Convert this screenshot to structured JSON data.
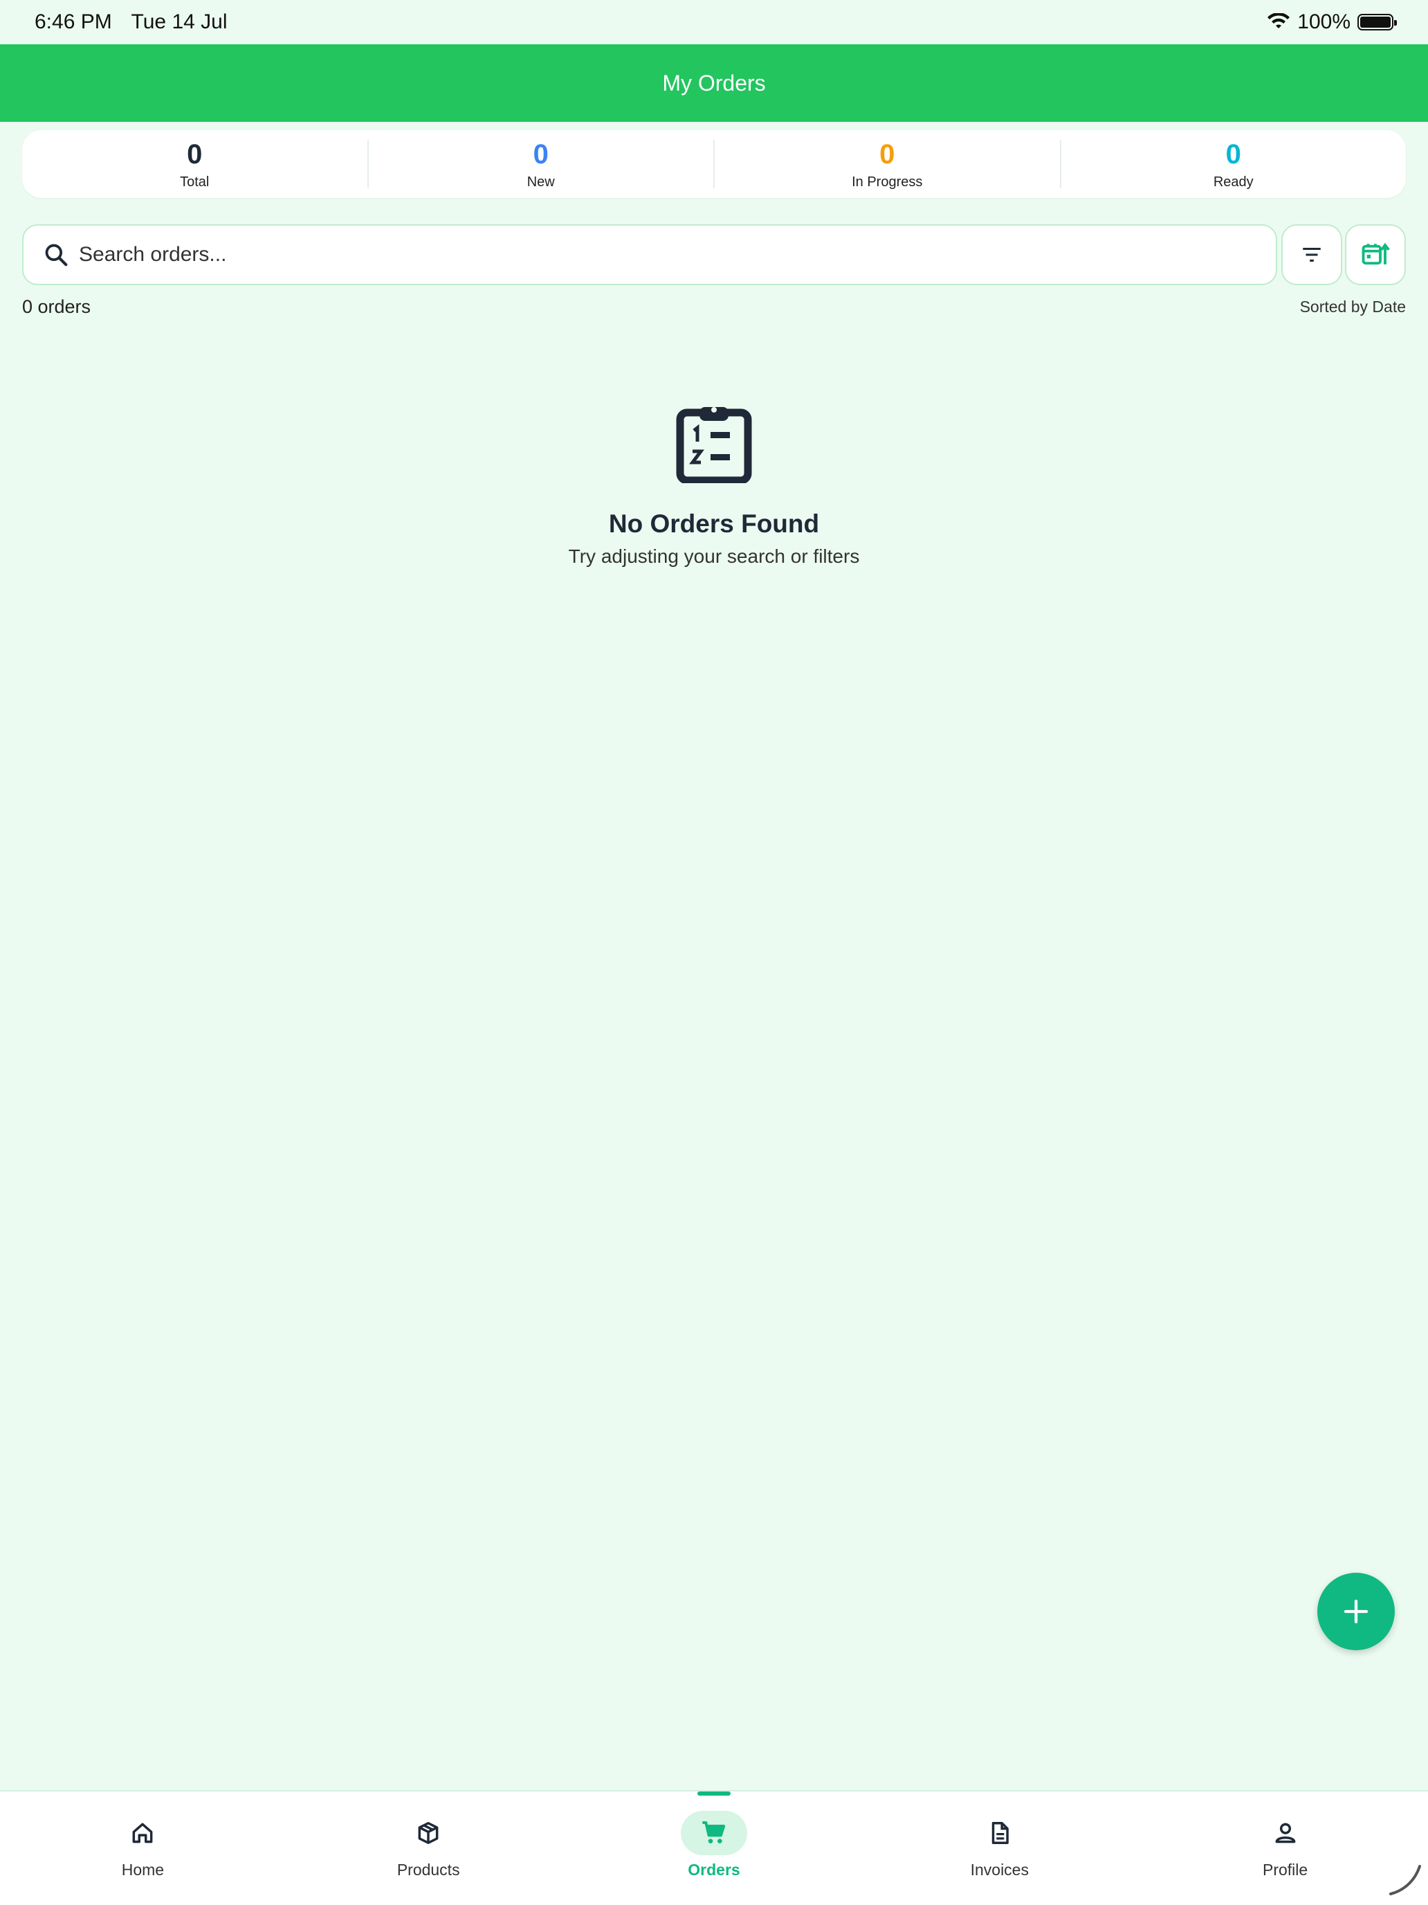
{
  "status_bar": {
    "time": "6:46 PM",
    "date": "Tue 14 Jul",
    "battery": "100%"
  },
  "header": {
    "title": "My Orders"
  },
  "stats": [
    {
      "value": "0",
      "label": "Total",
      "color": "#1f2937"
    },
    {
      "value": "0",
      "label": "New",
      "color": "#3b82f6"
    },
    {
      "value": "0",
      "label": "In Progress",
      "color": "#f59e0b"
    },
    {
      "value": "0",
      "label": "Ready",
      "color": "#06b6d4"
    }
  ],
  "search": {
    "placeholder": "Search orders...",
    "value": ""
  },
  "list_info": {
    "count": "0 orders",
    "sort": "Sorted by Date"
  },
  "empty_state": {
    "icon": "clipboard-list-icon",
    "title": "No Orders Found",
    "subtitle": "Try adjusting your search or filters"
  },
  "fab": {
    "icon": "plus-icon"
  },
  "bottom_nav": [
    {
      "label": "Home",
      "icon": "home-icon",
      "active": false
    },
    {
      "label": "Products",
      "icon": "box-icon",
      "active": false
    },
    {
      "label": "Orders",
      "icon": "cart-icon",
      "active": true
    },
    {
      "label": "Invoices",
      "icon": "document-icon",
      "active": false
    },
    {
      "label": "Profile",
      "icon": "user-icon",
      "active": false
    }
  ],
  "colors": {
    "header": "#22c55e",
    "accent": "#10b981",
    "background": "#ecfbf1"
  }
}
